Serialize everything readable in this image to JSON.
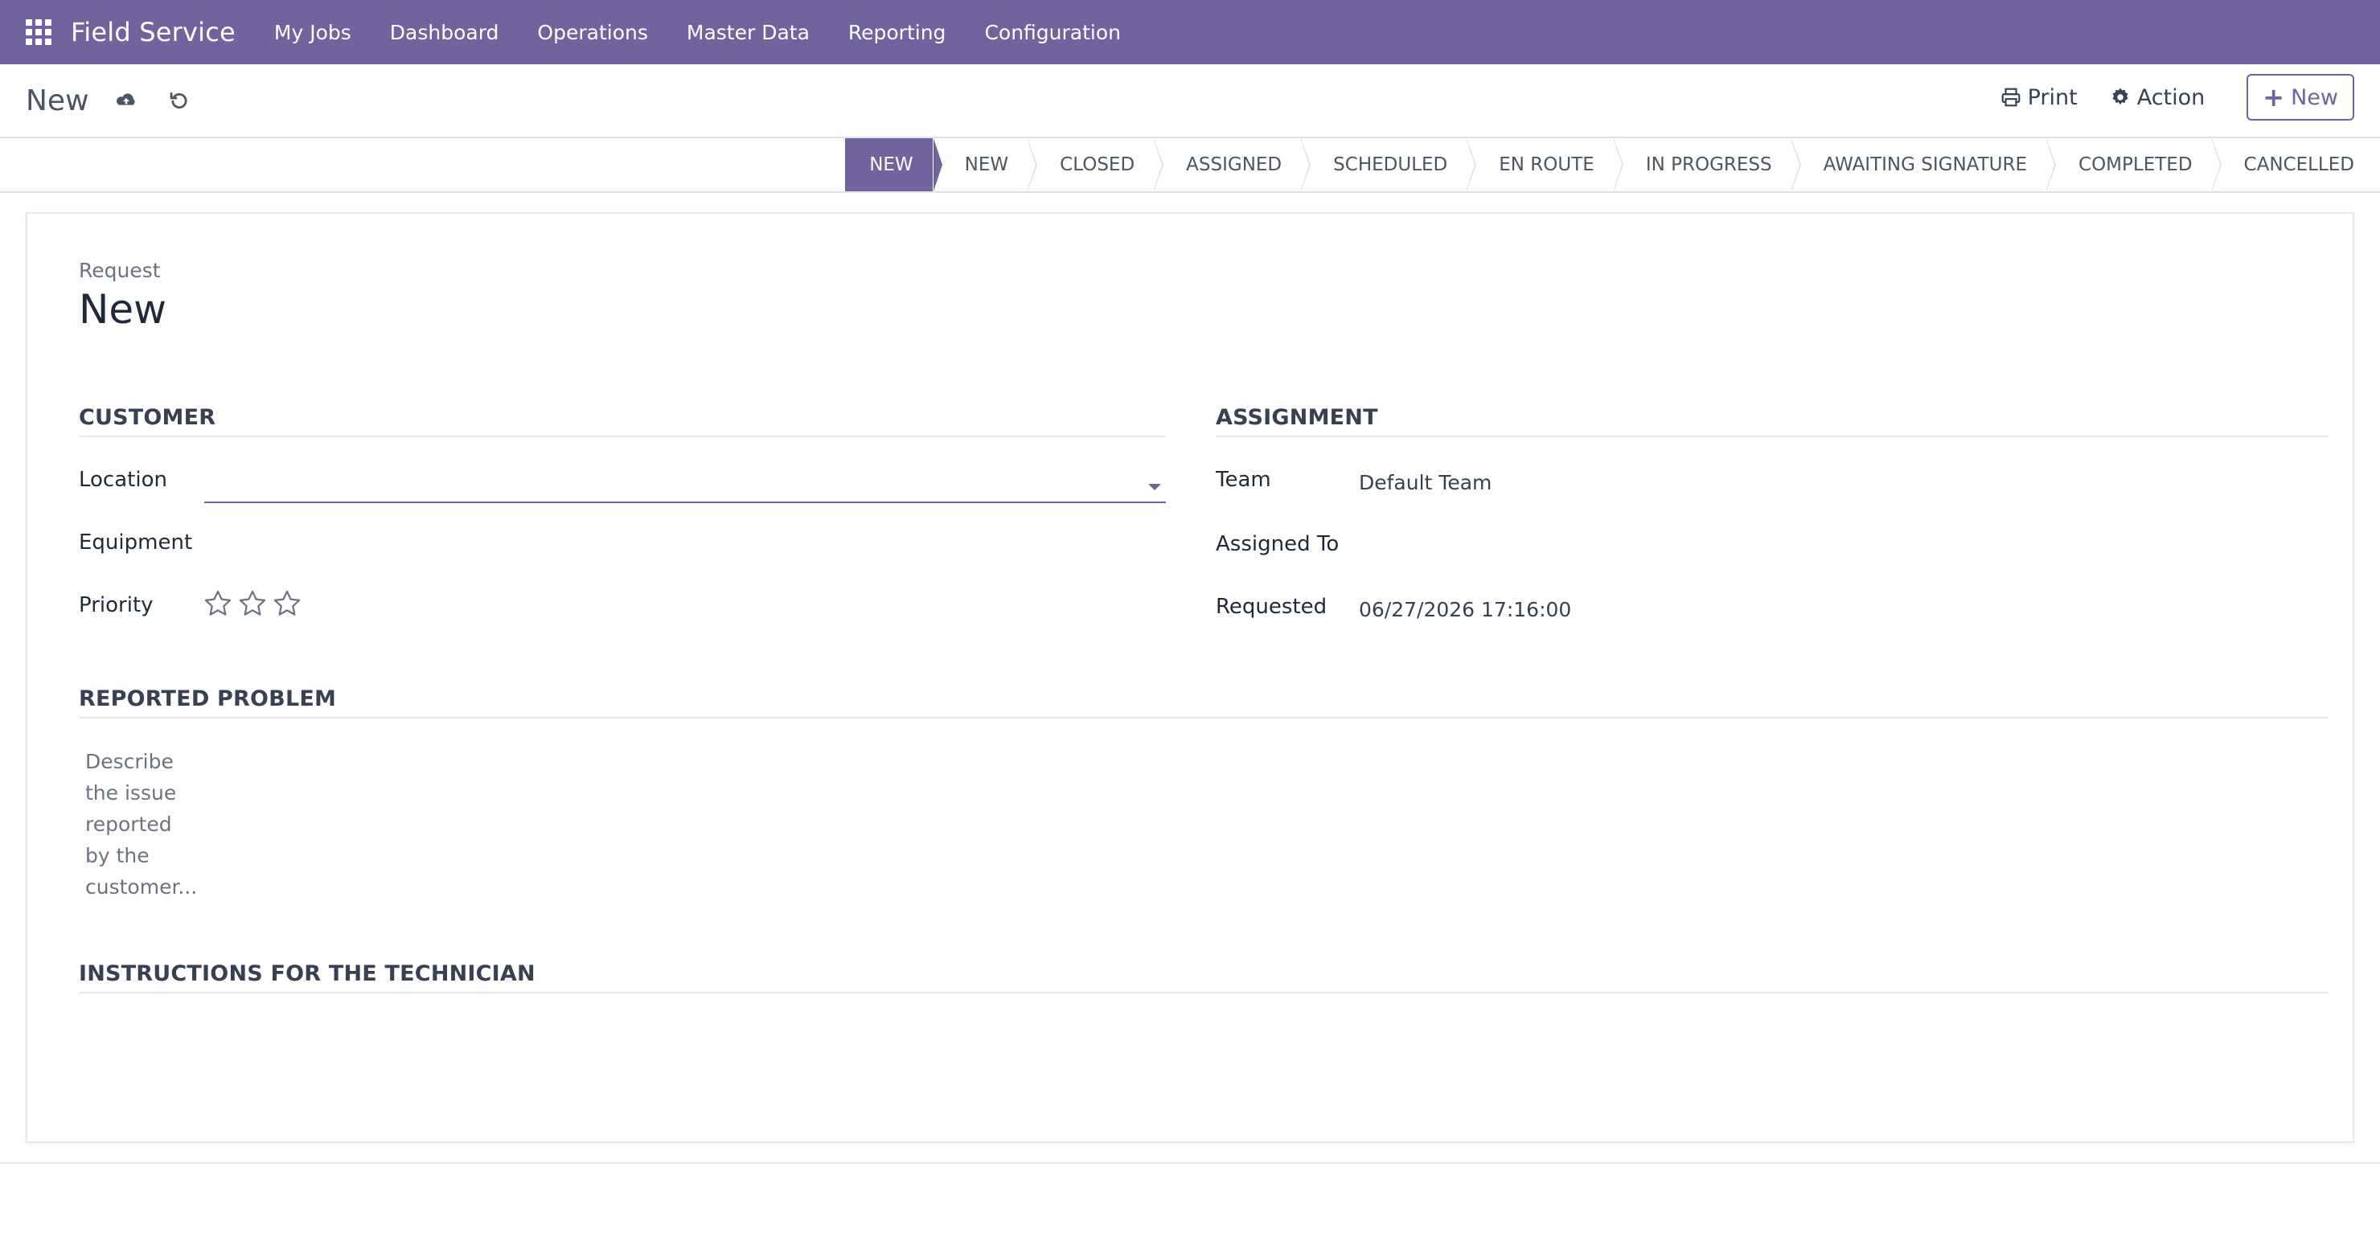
{
  "navbar": {
    "brand": "Field Service",
    "menu": [
      "My Jobs",
      "Dashboard",
      "Operations",
      "Master Data",
      "Reporting",
      "Configuration"
    ]
  },
  "control_panel": {
    "breadcrumb_title": "New",
    "print_label": "Print",
    "action_label": "Action",
    "new_label": "New"
  },
  "statusbar": {
    "stages": [
      "NEW",
      "NEW",
      "CLOSED",
      "ASSIGNED",
      "SCHEDULED",
      "EN ROUTE",
      "IN PROGRESS",
      "AWAITING SIGNATURE",
      "COMPLETED",
      "CANCELLED"
    ],
    "active_index": 0
  },
  "form": {
    "request_label": "Request",
    "request_name": "New",
    "customer": {
      "title": "CUSTOMER",
      "location_label": "Location",
      "location_value": "",
      "equipment_label": "Equipment",
      "priority_label": "Priority",
      "priority_stars_total": 3,
      "priority_stars_filled": 0
    },
    "assignment": {
      "title": "ASSIGNMENT",
      "team_label": "Team",
      "team_value": "Default Team",
      "assigned_to_label": "Assigned To",
      "requested_label": "Requested",
      "requested_value": "06/27/2026 17:16:00"
    },
    "reported_problem": {
      "title": "REPORTED PROBLEM",
      "placeholder": "Describe the issue reported by the customer..."
    },
    "instructions": {
      "title": "INSTRUCTIONS FOR THE TECHNICIAN"
    }
  },
  "colors": {
    "brand": "#71639e",
    "border": "#dee2e6"
  }
}
